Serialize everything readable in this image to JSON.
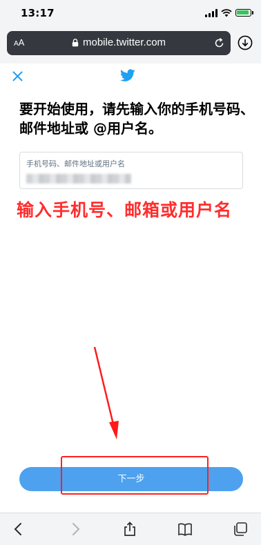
{
  "status_bar": {
    "time": "13:17"
  },
  "browser": {
    "text_size_label": "AA",
    "url": "mobile.twitter.com"
  },
  "page": {
    "heading": "要开始使用，请先输入你的手机号码、邮件地址或 @用户名。",
    "input_label": "手机号码、邮件地址或用户名",
    "next_button": "下一步"
  },
  "annotation": {
    "text": "输入手机号、邮箱或用户名",
    "color": "#ff2d2d"
  },
  "colors": {
    "twitter_blue": "#1da1f2",
    "button_blue": "#4da1ef"
  }
}
